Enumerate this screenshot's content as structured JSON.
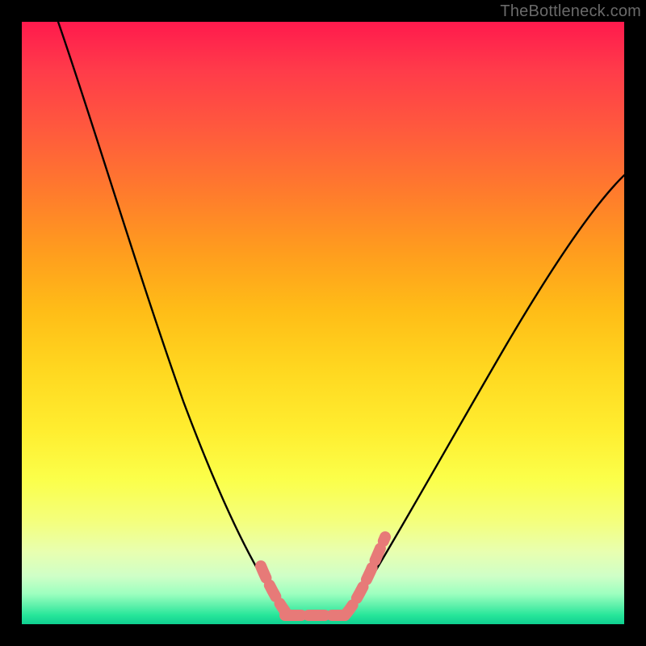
{
  "watermark": "TheBottleneck.com",
  "colors": {
    "page_bg": "#000000",
    "watermark": "#6a6a6a",
    "curve": "#000000",
    "highlight": "#e77a78",
    "gradient_top": "#ff1a4d",
    "gradient_bottom": "#0fcf90"
  },
  "chart_data": {
    "type": "line",
    "title": "",
    "xlabel": "",
    "ylabel": "",
    "xlim": [
      0,
      100
    ],
    "ylim": [
      0,
      100
    ],
    "annotations": [
      "TheBottleneck.com"
    ],
    "grid": false,
    "series": [
      {
        "name": "bottleneck-curve",
        "x": [
          0,
          5,
          10,
          15,
          20,
          25,
          30,
          33,
          36,
          38,
          40,
          42,
          45,
          48,
          50,
          55,
          60,
          65,
          70,
          75,
          80,
          85,
          90,
          95,
          100
        ],
        "y": [
          100,
          88,
          76,
          64,
          52,
          40,
          28,
          19,
          11,
          6,
          3,
          1,
          0,
          0,
          1,
          5,
          12,
          20,
          28,
          36,
          44,
          51,
          57,
          61,
          64
        ]
      },
      {
        "name": "highlight-segment",
        "x": [
          36,
          38,
          40,
          42,
          45,
          48,
          50,
          52
        ],
        "y": [
          11,
          6,
          3,
          1,
          0,
          0,
          1,
          5
        ]
      }
    ]
  }
}
